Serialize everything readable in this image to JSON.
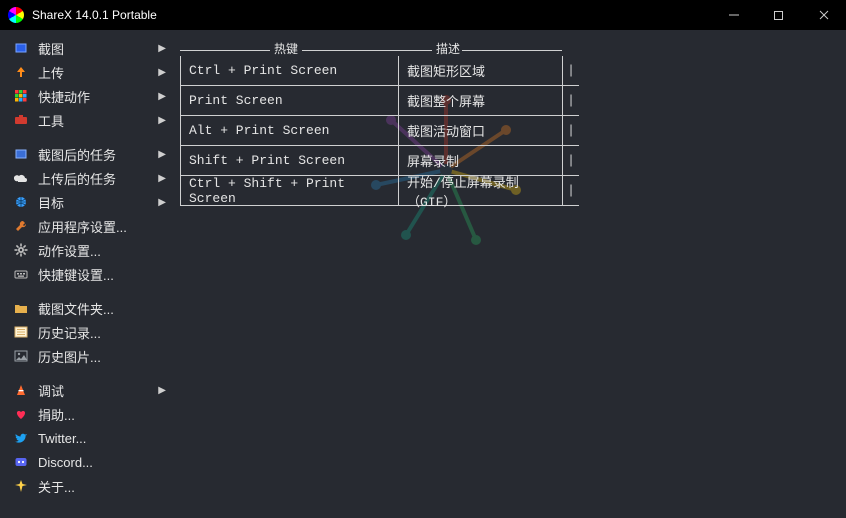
{
  "window": {
    "title": "ShareX 14.0.1 Portable"
  },
  "sidebar": {
    "groups": [
      [
        {
          "label": "截图",
          "icon": "capture-icon",
          "hasSubmenu": true
        },
        {
          "label": "上传",
          "icon": "upload-icon",
          "hasSubmenu": true
        },
        {
          "label": "快捷动作",
          "icon": "apps-icon",
          "hasSubmenu": true
        },
        {
          "label": "工具",
          "icon": "toolbox-icon",
          "hasSubmenu": true
        }
      ],
      [
        {
          "label": "截图后的任务",
          "icon": "after-capture-icon",
          "hasSubmenu": true
        },
        {
          "label": "上传后的任务",
          "icon": "after-upload-icon",
          "hasSubmenu": true
        },
        {
          "label": "目标",
          "icon": "target-icon",
          "hasSubmenu": true
        },
        {
          "label": "应用程序设置...",
          "icon": "settings-icon",
          "hasSubmenu": false
        },
        {
          "label": "动作设置...",
          "icon": "gear-icon",
          "hasSubmenu": false
        },
        {
          "label": "快捷键设置...",
          "icon": "keyboard-icon",
          "hasSubmenu": false
        }
      ],
      [
        {
          "label": "截图文件夹...",
          "icon": "folder-icon",
          "hasSubmenu": false
        },
        {
          "label": "历史记录...",
          "icon": "history-icon",
          "hasSubmenu": false
        },
        {
          "label": "历史图片...",
          "icon": "image-history-icon",
          "hasSubmenu": false
        }
      ],
      [
        {
          "label": "调试",
          "icon": "debug-icon",
          "hasSubmenu": true
        },
        {
          "label": "捐助...",
          "icon": "heart-icon",
          "hasSubmenu": false
        },
        {
          "label": "Twitter...",
          "icon": "twitter-icon",
          "hasSubmenu": false
        },
        {
          "label": "Discord...",
          "icon": "discord-icon",
          "hasSubmenu": false
        },
        {
          "label": "关于...",
          "icon": "about-icon",
          "hasSubmenu": false
        }
      ]
    ]
  },
  "hotkey_table": {
    "header_hotkey": "热键",
    "header_desc": "描述",
    "rows": [
      {
        "hotkey": "Ctrl + Print Screen",
        "desc": "截图矩形区域"
      },
      {
        "hotkey": "Print Screen",
        "desc": "截图整个屏幕"
      },
      {
        "hotkey": "Alt + Print Screen",
        "desc": "截图活动窗口"
      },
      {
        "hotkey": "Shift + Print Screen",
        "desc": "屏幕录制"
      },
      {
        "hotkey": "Ctrl + Shift + Print Screen",
        "desc": "开始/停止屏幕录制（GIF）"
      }
    ],
    "trail_char": "|"
  },
  "icons": {
    "capture-icon": {
      "type": "rect",
      "fill": "#2a5fe8",
      "stroke": "#7aa4ff"
    },
    "upload-icon": {
      "type": "arrow-up",
      "fill": "#ff8c1a"
    },
    "apps-icon": {
      "type": "grid",
      "colors": [
        "#ff3b3b",
        "#2fd82f",
        "#ff3b3b",
        "#2fd82f",
        "#ffb400",
        "#2aa9ff",
        "#ffb400",
        "#2aa9ff",
        "#ff3b3b"
      ]
    },
    "toolbox-icon": {
      "type": "rect-solid",
      "fill": "#d13a2f"
    },
    "after-capture-icon": {
      "type": "rect",
      "fill": "#3a6ed6",
      "stroke": "#8ab3ff"
    },
    "after-upload-icon": {
      "type": "cloud",
      "fill": "#e4e4e4"
    },
    "target-icon": {
      "type": "globe",
      "fill": "#3aa0ff"
    },
    "settings-icon": {
      "type": "wrench",
      "fill": "#e07a2f"
    },
    "gear-icon": {
      "type": "gear",
      "fill": "#bdbdbd"
    },
    "keyboard-icon": {
      "type": "keyboard",
      "fill": "#bcbcbc"
    },
    "folder-icon": {
      "type": "folder",
      "fill": "#e6b04d"
    },
    "history-icon": {
      "type": "list",
      "fill": "#d9b06a"
    },
    "image-history-icon": {
      "type": "image",
      "fill": "#9aa0a6"
    },
    "debug-icon": {
      "type": "cone",
      "fill": "#ff6a2f"
    },
    "heart-icon": {
      "type": "heart",
      "fill": "#ff2d55"
    },
    "twitter-icon": {
      "type": "twitter",
      "fill": "#1da1f2"
    },
    "discord-icon": {
      "type": "discord",
      "fill": "#5865f2"
    },
    "about-icon": {
      "type": "sparkle",
      "fill": "#ffd24a"
    }
  }
}
